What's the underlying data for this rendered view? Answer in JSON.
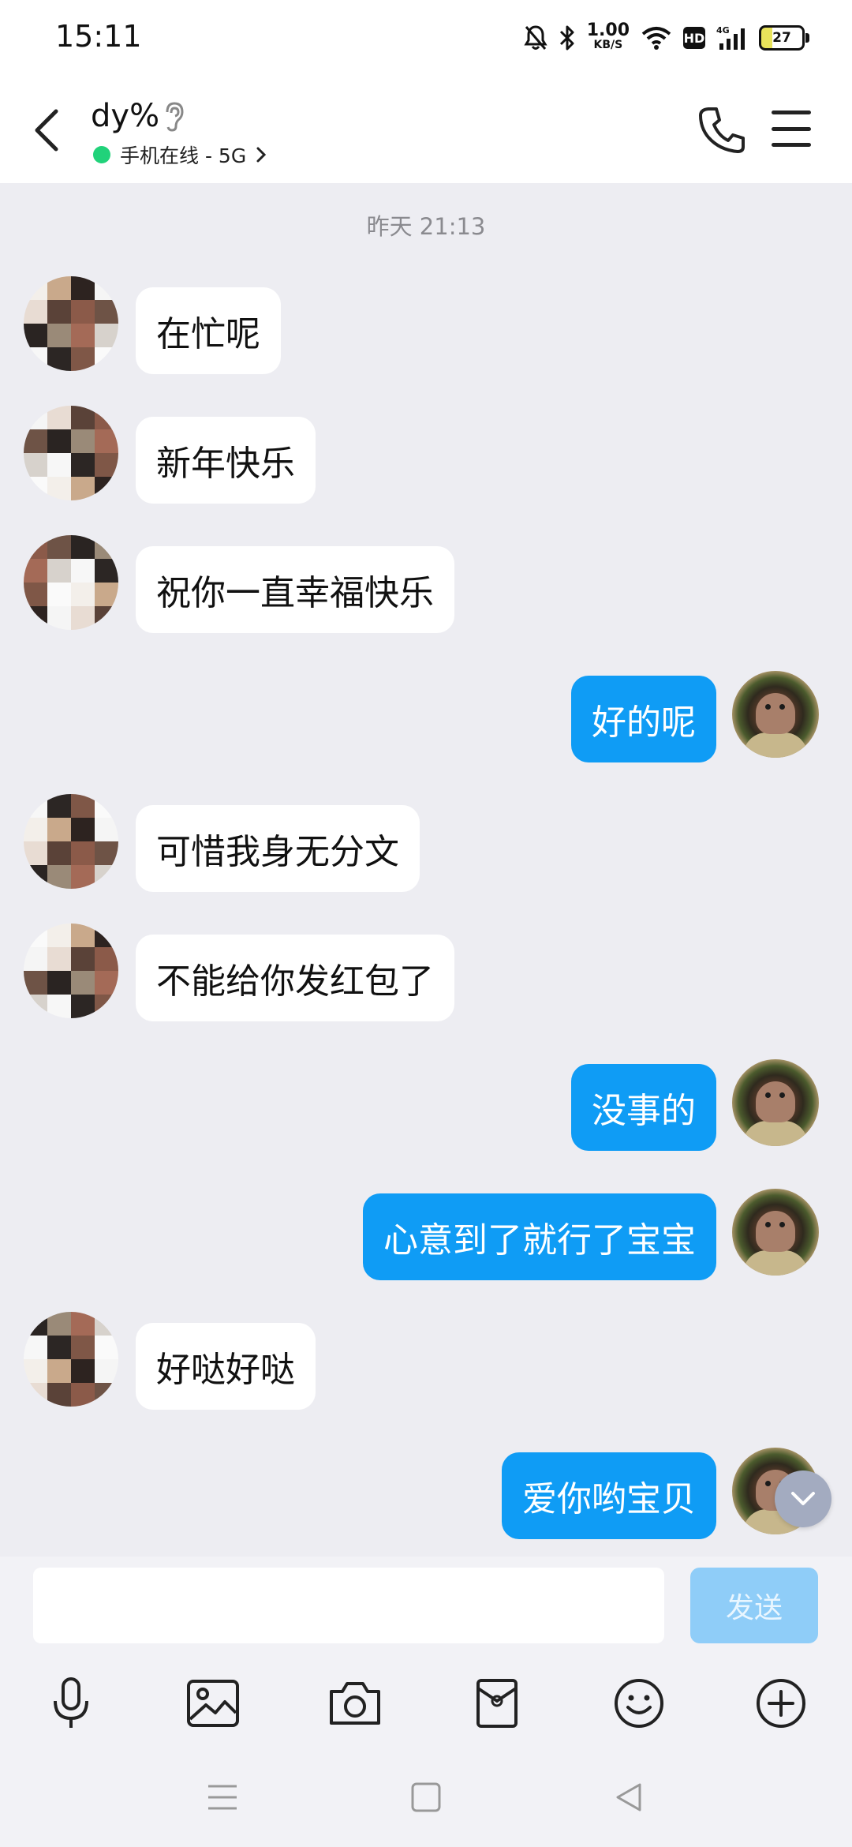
{
  "status_bar": {
    "time": "15:11",
    "net_speed_value": "1.00",
    "net_speed_unit": "KB/S",
    "hd_label": "HD",
    "network_label": "4G",
    "battery_level": "27"
  },
  "header": {
    "title": "dy%",
    "status_text": "手机在线 - 5G",
    "status_color": "#21d27a"
  },
  "chat": {
    "time_separator": "昨天 21:13",
    "messages": [
      {
        "side": "in",
        "text": "在忙呢"
      },
      {
        "side": "in",
        "text": "新年快乐"
      },
      {
        "side": "in",
        "text": "祝你一直幸福快乐"
      },
      {
        "side": "out",
        "text": "好的呢"
      },
      {
        "side": "in",
        "text": "可惜我身无分文"
      },
      {
        "side": "in",
        "text": "不能给你发红包了"
      },
      {
        "side": "out",
        "text": "没事的"
      },
      {
        "side": "out",
        "text": "心意到了就行了宝宝"
      },
      {
        "side": "in",
        "text": "好哒好哒"
      },
      {
        "side": "out",
        "text": "爱你哟宝贝"
      }
    ]
  },
  "composer": {
    "input_value": "",
    "send_label": "发送"
  },
  "toolbar_icons": [
    "microphone-icon",
    "image-icon",
    "camera-icon",
    "red-packet-icon",
    "emoji-icon",
    "plus-icon"
  ],
  "nav_icons": [
    "recent-apps-icon",
    "home-icon",
    "back-icon"
  ],
  "colors": {
    "outgoing_bubble": "#0f9cf5",
    "incoming_bubble": "#ffffff",
    "chat_background": "#ededf2",
    "send_button_disabled": "#8fcdf8"
  }
}
